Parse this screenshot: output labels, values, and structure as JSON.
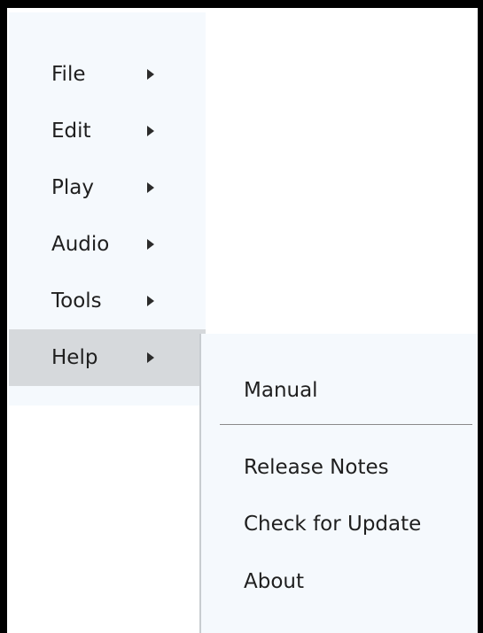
{
  "menu": {
    "items": [
      {
        "label": "File"
      },
      {
        "label": "Edit"
      },
      {
        "label": "Play"
      },
      {
        "label": "Audio"
      },
      {
        "label": "Tools"
      },
      {
        "label": "Help"
      }
    ],
    "selected": "Help"
  },
  "help_submenu": {
    "items": [
      {
        "label": "Manual"
      },
      {
        "label": "Release Notes"
      },
      {
        "label": "Check for Update"
      },
      {
        "label": "About"
      }
    ]
  },
  "colors": {
    "menu_background": "#f5f9fd",
    "selected_background": "#d6d9dc",
    "text": "#1f1f1f",
    "separator": "#8a8a8a"
  }
}
